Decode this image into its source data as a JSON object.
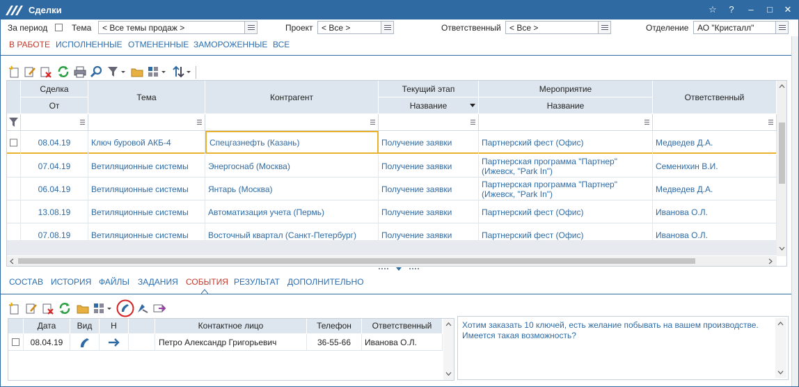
{
  "window": {
    "title": "Сделки",
    "star": "☆",
    "help": "?",
    "minimize": "–",
    "maximize": "□",
    "close": "✕"
  },
  "filters": {
    "period_label": "За период",
    "theme_label": "Тема",
    "theme_value": "< Все темы продаж >",
    "project_label": "Проект",
    "project_value": "< Все >",
    "responsible_label": "Ответственный",
    "responsible_value": "< Все >",
    "department_label": "Отделение",
    "department_value": "АО \"Кристалл\""
  },
  "status_tabs": [
    "В РАБОТЕ",
    "ИСПОЛНЕННЫЕ",
    "ОТМЕНЕННЫЕ",
    "ЗАМОРОЖЕННЫЕ",
    "ВСЕ"
  ],
  "toolbar_icons": [
    "new-icon",
    "edit-icon",
    "delete-icon",
    "refresh-icon",
    "print-icon",
    "search-icon",
    "filter-icon",
    "folder-icon",
    "view-icon",
    "sort-icon"
  ],
  "grid": {
    "header": {
      "deal": "Сделка",
      "deal_from": "От",
      "theme": "Тема",
      "contractor": "Контрагент",
      "stage": "Текущий этап",
      "stage_name": "Название",
      "event": "Мероприятие",
      "event_name": "Название",
      "responsible": "Ответственный"
    },
    "rows": [
      {
        "date": "08.04.19",
        "theme": "Ключ буровой АКБ-4",
        "contractor": "Спецгазнефть (Казань)",
        "stage": "Получение заявки",
        "event": "Партнерский фест (Офис)",
        "responsible": "Медведев Д.А."
      },
      {
        "date": "07.04.19",
        "theme": "Ветиляционные системы",
        "contractor": "Энергоснаб (Москва)",
        "stage": "Получение заявки",
        "event": "Партнерская программа \"Партнер\" (Ижевск, \"Park In\")",
        "responsible": "Семенихин В.И."
      },
      {
        "date": "06.04.19",
        "theme": "Ветиляционные системы",
        "contractor": "Янтарь (Москва)",
        "stage": "Получение заявки",
        "event": "Партнерская программа \"Партнер\" (Ижевск, \"Park In\")",
        "responsible": "Медведев Д.А."
      },
      {
        "date": "13.08.19",
        "theme": "Ветиляционные системы",
        "contractor": "Автоматизация учета (Пермь)",
        "stage": "Получение заявки",
        "event": "Партнерский фест (Офис)",
        "responsible": "Иванова О.Л."
      },
      {
        "date": "07.08.19",
        "theme": "Ветиляционные системы",
        "contractor": "Восточный квартал (Санкт-Петербург)",
        "stage": "Получение заявки",
        "event": "Партнерский фест (Офис)",
        "responsible": "Иванова О.Л."
      }
    ]
  },
  "detail_tabs": [
    "СОСТАВ",
    "ИСТОРИЯ",
    "ФАЙЛЫ",
    "ЗАДАНИЯ",
    "СОБЫТИЯ",
    "РЕЗУЛЬТАТ",
    "ДОПОЛНИТЕЛЬНО"
  ],
  "events": {
    "header": {
      "date": "Дата",
      "kind": "Вид",
      "direction": "Н",
      "contact": "Контактное лицо",
      "phone": "Телефон",
      "responsible": "Ответственный"
    },
    "rows": [
      {
        "date": "08.04.19",
        "kind_icon": "phone-icon",
        "direction_icon": "arrow-right-icon",
        "contact": "Петро Александр Григорьевич",
        "phone": "36-55-66",
        "responsible": "Иванова О.Л."
      }
    ]
  },
  "memo": {
    "text": "Хотим заказать 10 ключей, есть желание побывать на вашем производстве. Имеется такая возможность?"
  },
  "colors": {
    "accent": "#2f6aa3",
    "header_bg": "#dde6ee",
    "active_tab": "#c0392b",
    "selected_row_line": "#e8b22e"
  }
}
